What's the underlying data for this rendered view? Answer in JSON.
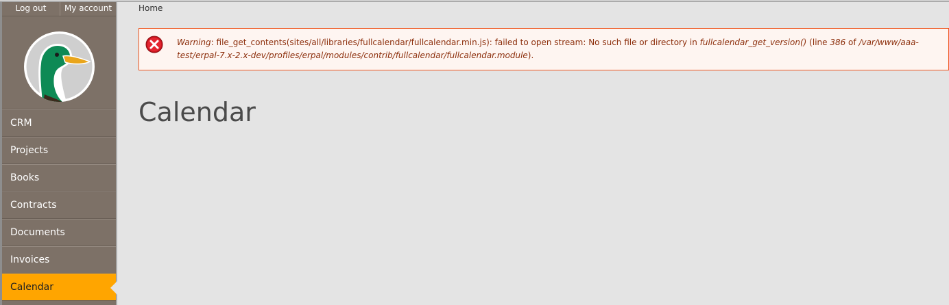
{
  "account": {
    "logout_label": "Log out",
    "my_account_label": "My account"
  },
  "logo": {
    "icon": "duck-logo-icon"
  },
  "nav": {
    "items": [
      {
        "label": "CRM"
      },
      {
        "label": "Projects"
      },
      {
        "label": "Books"
      },
      {
        "label": "Contracts"
      },
      {
        "label": "Documents"
      },
      {
        "label": "Invoices"
      },
      {
        "label": "Calendar",
        "active": true
      }
    ]
  },
  "breadcrumb": {
    "home": "Home"
  },
  "warning": {
    "label": "Warning",
    "text_1": ": file_get_contents(sites/all/libraries/fullcalendar/fullcalendar.min.js): failed to open stream: No such file or directory in ",
    "function": "fullcalendar_get_version()",
    "text_2": " (line ",
    "line": "386",
    "text_3": " of ",
    "path": "/var/www/aaa-test/erpal-7.x-2.x-dev/profiles/erpal/modules/contrib/fullcalendar/fullcalendar.module",
    "text_4": ").",
    "icon": "error-icon"
  },
  "page": {
    "title": "Calendar"
  },
  "colors": {
    "sidebar": "#7d7167",
    "active": "#ffa500",
    "warning_border": "#ed541d",
    "warning_text": "#8c2e0b"
  }
}
